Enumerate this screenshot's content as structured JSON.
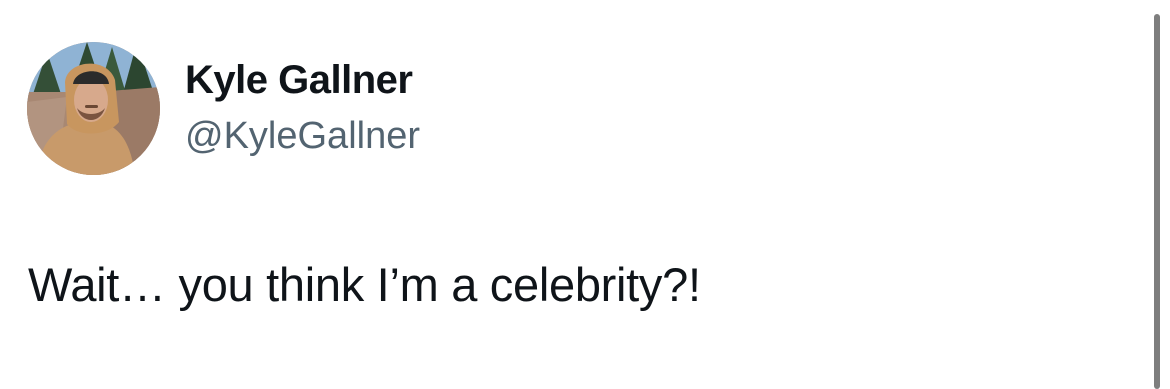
{
  "tweet": {
    "display_name": "Kyle Gallner",
    "handle": "@KyleGallner",
    "text": "Wait… you think I’m a celebrity?!"
  },
  "icons": {
    "avatar": "profile-photo"
  },
  "colors": {
    "text_primary": "#0f1419",
    "text_secondary": "#536471",
    "background": "#ffffff",
    "scrollbar": "#7e7e7e"
  }
}
